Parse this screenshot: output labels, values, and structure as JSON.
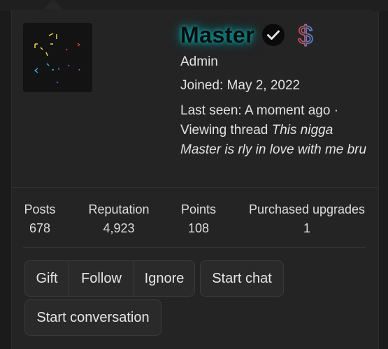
{
  "profile": {
    "username": "Master",
    "role": "Admin",
    "joined": "Joined: May 2, 2022",
    "last_seen_prefix": "Last seen: A moment ago · Viewing thread ",
    "last_seen_thread": "This nigga Master is rly in love with me bru",
    "verified_icon": "verified-check-icon",
    "premium_icon": "dollar-sign-icon"
  },
  "stats": [
    {
      "label": "Posts",
      "value": "678"
    },
    {
      "label": "Reputation",
      "value": "4,923"
    },
    {
      "label": "Points",
      "value": "108"
    },
    {
      "label": "Purchased upgrades",
      "value": "1"
    }
  ],
  "actions": {
    "gift": "Gift",
    "follow": "Follow",
    "ignore": "Ignore",
    "start_chat": "Start chat",
    "start_conversation": "Start conversation"
  },
  "colors": {
    "background": "#1b1b1b",
    "card": "#242424",
    "username_glow": "#16a3a6",
    "button_bg": "#2a2a2a"
  }
}
